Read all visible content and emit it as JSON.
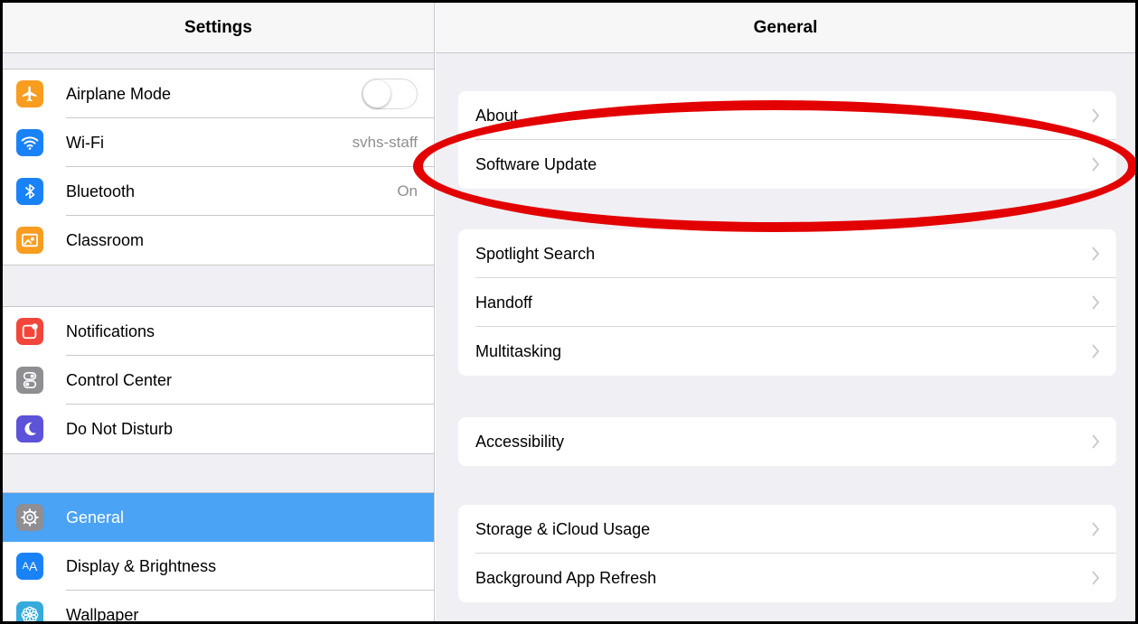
{
  "left_pane": {
    "title": "Settings",
    "groups": [
      [
        {
          "label": "Airplane Mode",
          "icon": "airplane-icon",
          "icon_color": "#f99d20",
          "glyph": "✈",
          "toggle_on": false
        },
        {
          "label": "Wi-Fi",
          "icon": "wifi-icon",
          "icon_color": "#1a82f7",
          "glyph": "",
          "value": "svhs-staff"
        },
        {
          "label": "Bluetooth",
          "icon": "bluetooth-icon",
          "icon_color": "#1a82f7",
          "glyph": "✱",
          "value": "On"
        },
        {
          "label": "Classroom",
          "icon": "classroom-icon",
          "icon_color": "#f99d20",
          "glyph": "▣"
        }
      ],
      [
        {
          "label": "Notifications",
          "icon": "notifications-icon",
          "icon_color": "#f2463a",
          "glyph": ""
        },
        {
          "label": "Control Center",
          "icon": "control-center-icon",
          "icon_color": "#8e8e93",
          "glyph": ""
        },
        {
          "label": "Do Not Disturb",
          "icon": "moon-icon",
          "icon_color": "#5c53d9",
          "glyph": "☾"
        }
      ],
      [
        {
          "label": "General",
          "icon": "gear-icon",
          "icon_color": "#8e8e93",
          "glyph": "⚙",
          "selected": true
        },
        {
          "label": "Display & Brightness",
          "icon": "display-brightness-icon",
          "icon_color": "#1a82f7",
          "glyph": "AA"
        },
        {
          "label": "Wallpaper",
          "icon": "wallpaper-icon",
          "icon_color": "#36aadc",
          "glyph": "❁"
        }
      ]
    ]
  },
  "right_pane": {
    "title": "General",
    "groups": [
      [
        "About",
        "Software Update"
      ],
      [
        "Spotlight Search",
        "Handoff",
        "Multitasking"
      ],
      [
        "Accessibility"
      ],
      [
        "Storage & iCloud Usage",
        "Background App Refresh"
      ]
    ]
  },
  "colors": {
    "selected_row": "#4aa3f4",
    "highlight_oval": "#e30000",
    "group_background": "#efeff4"
  }
}
